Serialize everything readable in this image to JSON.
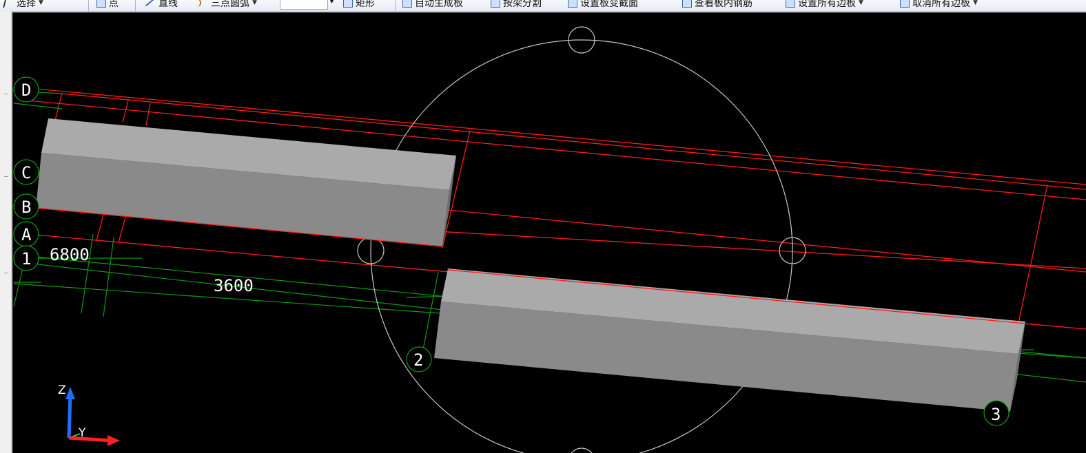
{
  "toolbar": {
    "items": [
      {
        "label": "选择",
        "icon": "select-cursor-icon",
        "has_dropdown": true
      },
      {
        "label": "点",
        "icon": "point-icon"
      },
      {
        "label": "直线",
        "icon": "line-icon"
      },
      {
        "label": "三点圆弧",
        "icon": "arc-icon",
        "has_dropdown": true
      },
      {
        "label": "矩形",
        "icon": "rectangle-icon"
      },
      {
        "label": "自动生成板",
        "icon": "auto-slab-icon"
      },
      {
        "label": "按梁分割",
        "icon": "split-by-beam-icon"
      },
      {
        "label": "设置板变截面",
        "icon": "slab-variable-section-icon"
      },
      {
        "label": "查看板内钢筋",
        "icon": "view-slab-rebar-icon"
      },
      {
        "label": "设置所有边板",
        "icon": "set-edge-slab-icon",
        "has_dropdown": true
      },
      {
        "label": "取消所有边板",
        "icon": "cancel-edge-slab-icon",
        "has_dropdown": true
      }
    ]
  },
  "viewport": {
    "background_color": "#000000",
    "grid_axis_labels": {
      "d": "D",
      "c": "C",
      "b": "B",
      "a": "A",
      "one": "1",
      "two": "2",
      "three": "3"
    },
    "dimensions": {
      "dim_6800": "6800",
      "dim_3600": "3600"
    },
    "ucs": {
      "z": "Z",
      "y": "Y",
      "x_color": "#ff2020",
      "z_color": "#1f6fff",
      "y_color": "#2fd02f"
    },
    "colors": {
      "red_lines": "#ff1a1a",
      "green_lines": "#109a10",
      "grid_circle": "#0f9f0f",
      "orbit_circle": "#c8c8c8",
      "beam_top": "#aaaaaa",
      "beam_front": "#8a8a8a",
      "beam_end": "#6f6f6f"
    }
  }
}
